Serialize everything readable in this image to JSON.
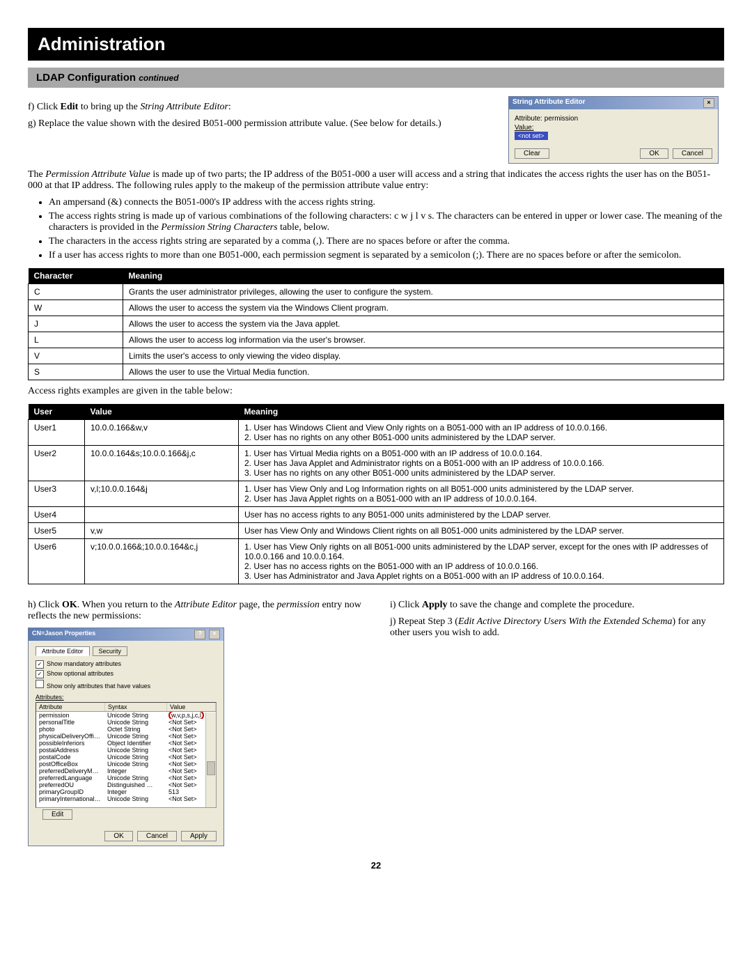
{
  "title": "Administration",
  "section": {
    "label": "LDAP Configuration",
    "cont": "continued"
  },
  "step_f": "f) Click Edit to bring up the String Attribute Editor:",
  "step_g": "g) Replace the value shown with the desired B051-000 permission attribute value. (See below for details.)",
  "para1": "The Permission Attribute Value is made up of two parts; the IP address of the B051-000 a user will access and a string that indicates the access rights the user has on the B051-000 at that IP address. The following rules apply to the makeup of the permission attribute value entry:",
  "bullets": [
    "An ampersand (&) connects the B051-000's IP address with the access rights string.",
    "The access rights string is made up of various combinations of the following characters: c w j l v s. The characters can be entered in upper or lower case. The meaning of the characters is provided in the Permission String Characters table, below.",
    "The characters in the access rights string are separated by a comma (,). There are no spaces before or after the comma.",
    "If a user has access rights to more than one B051-000, each permission segment is separated by a semicolon (;). There are no spaces before or after the semicolon."
  ],
  "char_table": {
    "headers": [
      "Character",
      "Meaning"
    ],
    "rows": [
      [
        "C",
        "Grants the user administrator privileges, allowing the user to configure the system."
      ],
      [
        "W",
        "Allows the user to access the system via the Windows Client program."
      ],
      [
        "J",
        "Allows the user to access the system via the Java applet."
      ],
      [
        "L",
        "Allows the user to access log information via the user's browser."
      ],
      [
        "V",
        "Limits the user's access to only viewing the video display."
      ],
      [
        "S",
        "Allows the user to use the Virtual Media function."
      ]
    ]
  },
  "examples_intro": "Access rights examples are given in the table below:",
  "ex_table": {
    "headers": [
      "User",
      "Value",
      "Meaning"
    ],
    "rows": [
      [
        "User1",
        "10.0.0.166&w,v",
        "1. User has Windows Client and View Only rights on a B051-000 with an IP address of 10.0.0.166.\n2. User has no rights on any other B051-000 units administered by the LDAP server."
      ],
      [
        "User2",
        "10.0.0.164&s;10.0.0.166&j,c",
        "1. User has Virtual Media rights on a B051-000 with an IP address of 10.0.0.164.\n2. User has Java Applet and Administrator rights on a B051-000 with an IP address of 10.0.0.166.\n3. User has no rights on any other B051-000 units administered by the LDAP server."
      ],
      [
        "User3",
        "v,l;10.0.0.164&j",
        "1. User has View Only and Log Information rights on all B051-000 units administered by the LDAP server.\n2. User has Java Applet rights on a B051-000 with an IP address of 10.0.0.164."
      ],
      [
        "User4",
        "",
        "User has no access rights to any B051-000 units administered by the LDAP server."
      ],
      [
        "User5",
        "v,w",
        "User has View Only and Windows Client rights on all B051-000 units administered by the LDAP server."
      ],
      [
        "User6",
        "v;10.0.0.166&;10.0.0.164&c,j",
        "1. User has View Only rights on all B051-000 units administered by the LDAP server, except for the ones with IP addresses of 10.0.0.166 and 10.0.0.164.\n2. User has no access rights on the B051-000 with an IP address of 10.0.0.166.\n3. User has Administrator and Java Applet rights on a B051-000 with an IP address of 10.0.0.164."
      ]
    ]
  },
  "step_h": "h) Click OK. When you return to the Attribute Editor page, the permission entry now reflects the new permissions:",
  "step_i": "i)  Click Apply to save the change and complete the procedure.",
  "step_j": "j)  Repeat Step 3 (Edit Active Directory Users With the Extended Schema) for any other users you wish to add.",
  "page_number": "22",
  "sae_dialog": {
    "title": "String Attribute Editor",
    "attr_label": "Attribute: permission",
    "value_label": "Value:",
    "highlighted_value": "<not set>",
    "clear": "Clear",
    "ok": "OK",
    "cancel": "Cancel"
  },
  "props_dialog": {
    "title": "CN=Jason Properties",
    "tabs": [
      "Attribute Editor",
      "Security"
    ],
    "chk1": "Show mandatory attributes",
    "chk2": "Show optional attributes",
    "chk3": "Show only attributes that have values",
    "attrs_label": "Attributes:",
    "columns": [
      "Attribute",
      "Syntax",
      "Value"
    ],
    "rows": [
      [
        "permission",
        "Unicode String",
        "w,v,p,s,j,c,l"
      ],
      [
        "personalTitle",
        "Unicode String",
        "<Not Set>"
      ],
      [
        "photo",
        "Octet String",
        "<Not Set>"
      ],
      [
        "physicalDeliveryOffic…",
        "Unicode String",
        "<Not Set>"
      ],
      [
        "possibleInferiors",
        "Object Identifier",
        "<Not Set>"
      ],
      [
        "postalAddress",
        "Unicode String",
        "<Not Set>"
      ],
      [
        "postalCode",
        "Unicode String",
        "<Not Set>"
      ],
      [
        "postOfficeBox",
        "Unicode String",
        "<Not Set>"
      ],
      [
        "preferredDeliveryMet…",
        "Integer",
        "<Not Set>"
      ],
      [
        "preferredLanguage",
        "Unicode String",
        "<Not Set>"
      ],
      [
        "preferredOU",
        "Distinguished …",
        "<Not Set>"
      ],
      [
        "primaryGroupID",
        "Integer",
        "513"
      ],
      [
        "primaryInternationalIS…",
        "Unicode String",
        "<Not Set>"
      ]
    ],
    "edit": "Edit",
    "ok": "OK",
    "cancel": "Cancel",
    "apply": "Apply"
  }
}
